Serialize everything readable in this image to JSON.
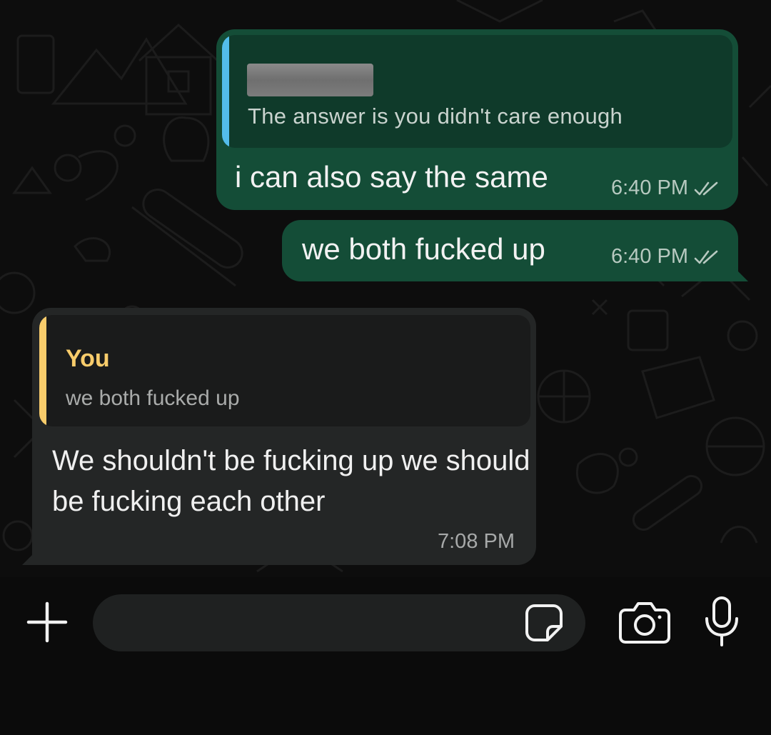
{
  "conversation": {
    "messages": [
      {
        "direction": "outgoing",
        "reply_to": {
          "author": "",
          "text": "The answer is you didn't care enough"
        },
        "text": "i can also say the same",
        "time": "6:40 PM",
        "status": "read"
      },
      {
        "direction": "outgoing",
        "text": "we both fucked up",
        "time": "6:40 PM",
        "status": "read"
      },
      {
        "direction": "incoming",
        "reply_to": {
          "author": "You",
          "text": "we both fucked up"
        },
        "text": "We shouldn't be fucking up we should be fucking each other",
        "time": "7:08 PM"
      }
    ]
  },
  "composer": {
    "placeholder": "",
    "icons": {
      "attach": "plus-icon",
      "sticker": "sticker-icon",
      "camera": "camera-icon",
      "voice": "microphone-icon"
    }
  },
  "colors": {
    "outgoing_bubble": "#144d37",
    "incoming_bubble": "#242626",
    "quote_bar_outgoing": "#53bdeb",
    "quote_bar_incoming": "#f8cc6b",
    "background": "#0d0d0d"
  }
}
